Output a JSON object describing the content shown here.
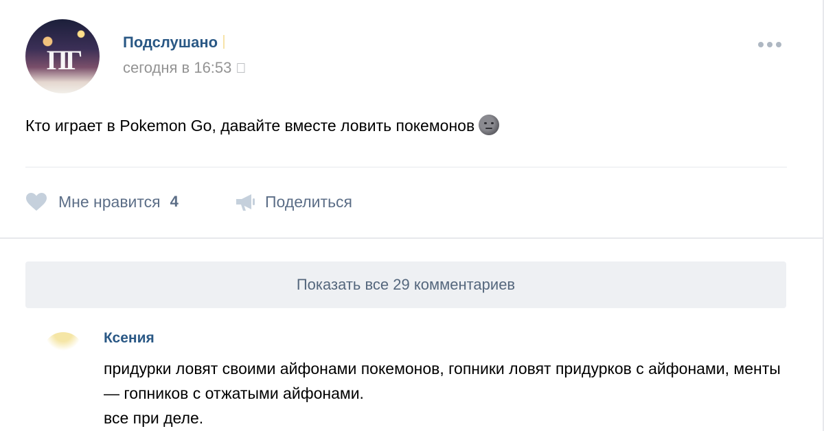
{
  "post": {
    "author": "Подслушано",
    "time": "сегодня в 16:53",
    "platform_icon": "apple-icon",
    "text": "Кто играет в Pokemon Go, давайте вместе ловить покемонов",
    "emoji": "new-moon-face-emoji"
  },
  "actions": {
    "like_label": "Мне нравится",
    "like_count": "4",
    "share_label": "Поделиться"
  },
  "comments": {
    "show_all_label": "Показать все 29 комментариев",
    "items": [
      {
        "author": "Ксения",
        "text": "придурки ловят своими айфонами покемонов, гопники ловят придурков с айфонами, менты — гопников с отжатыми айфонами.\nвсе при деле."
      }
    ]
  },
  "colors": {
    "link": "#2a5885",
    "action": "#5c6e87",
    "muted": "#939393",
    "panel": "#eef0f3"
  }
}
